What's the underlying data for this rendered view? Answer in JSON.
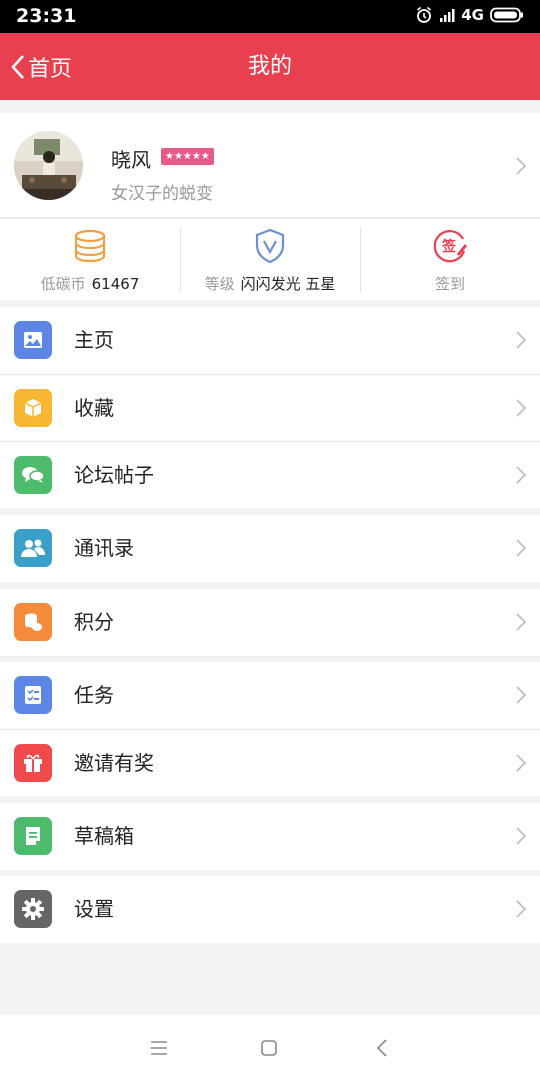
{
  "status_bar": {
    "time": "23:31",
    "network": "4G"
  },
  "nav": {
    "back_label": "首页",
    "title": "我的"
  },
  "profile": {
    "name": "晓风",
    "badge": "★★★★★",
    "motto": "女汉子的蜕变"
  },
  "stats": [
    {
      "label": "低碳币",
      "value": "61467",
      "icon": "coins-icon",
      "color": "#f0a040"
    },
    {
      "label": "等级",
      "value": "闪闪发光 五星",
      "icon": "shield-icon",
      "color": "#6b8fd6"
    },
    {
      "label": "签到",
      "value": "",
      "icon": "sign-in-icon",
      "color": "#e94050"
    }
  ],
  "menu_groups": [
    [
      {
        "label": "主页",
        "icon": "image-icon",
        "color": "#5b86e5"
      },
      {
        "label": "收藏",
        "icon": "box-icon",
        "color": "#f7b733"
      },
      {
        "label": "论坛帖子",
        "icon": "chat-icon",
        "color": "#4cbb6c"
      }
    ],
    [
      {
        "label": "通讯录",
        "icon": "contacts-icon",
        "color": "#3aa0c8"
      }
    ],
    [
      {
        "label": "积分",
        "icon": "points-icon",
        "color": "#f58b3a"
      }
    ],
    [
      {
        "label": "任务",
        "icon": "task-icon",
        "color": "#5b86e5"
      },
      {
        "label": "邀请有奖",
        "icon": "gift-icon",
        "color": "#f04a4a"
      }
    ],
    [
      {
        "label": "草稿箱",
        "icon": "draft-icon",
        "color": "#4cbb6c"
      }
    ],
    [
      {
        "label": "设置",
        "icon": "gear-icon",
        "color": "#666666"
      }
    ]
  ]
}
